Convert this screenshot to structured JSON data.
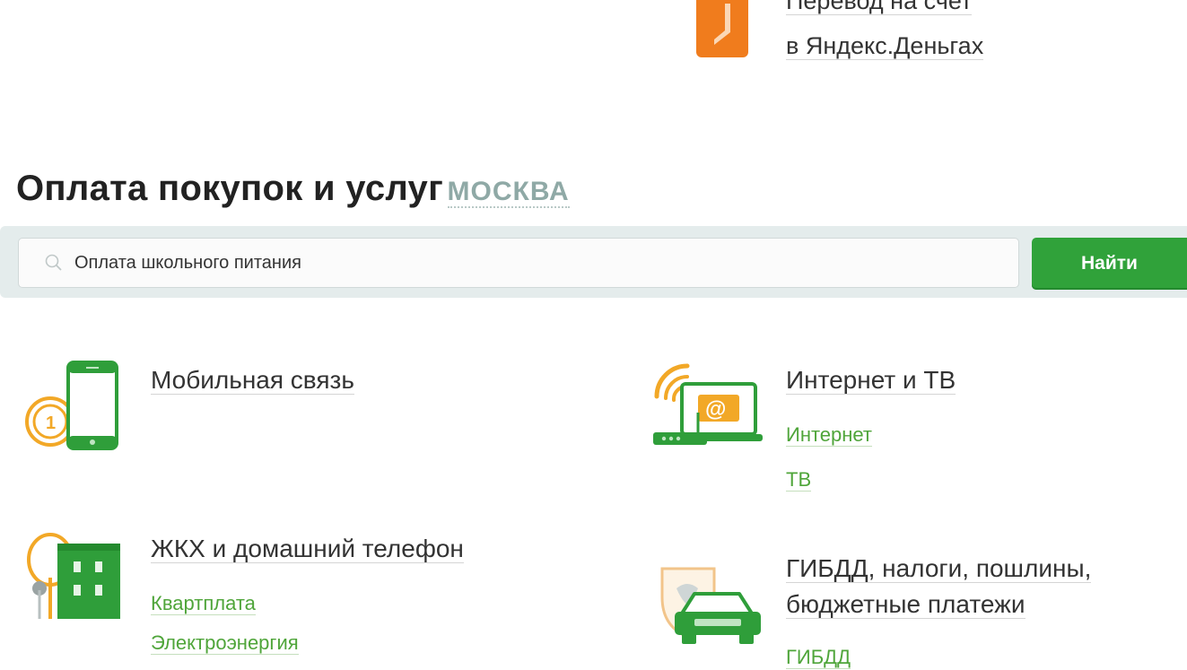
{
  "top_link": {
    "line1": "Перевод на счет",
    "line2": "в Яндекс.Деньгах"
  },
  "header": {
    "title": "Оплата покупок и услуг",
    "city": "МОСКВА"
  },
  "search": {
    "value": "Оплата школьного питания",
    "button_label": "Найти"
  },
  "categories": {
    "mobile": {
      "title": "Мобильная связь"
    },
    "internet": {
      "title": "Интернет и ТВ",
      "links": [
        "Интернет",
        "ТВ"
      ]
    },
    "housing": {
      "title": "ЖКХ и домашний телефон",
      "links": [
        "Квартплата",
        "Электроэнергия"
      ]
    },
    "gibdd": {
      "title_line1": "ГИБДД, налоги, пошлины,",
      "title_line2": "бюджетные платежи",
      "links": [
        "ГИБДД"
      ]
    }
  },
  "colors": {
    "accent_green": "#30a23a",
    "link_green": "#4fa53a",
    "city_gray": "#8fa9a6",
    "icon_orange": "#f07c1d",
    "icon_yellow": "#f2a827"
  }
}
